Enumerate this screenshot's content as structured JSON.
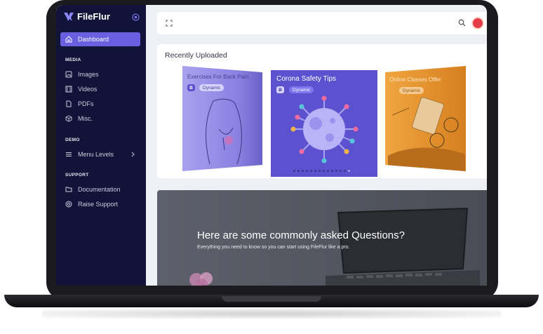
{
  "app": {
    "name": "FileFlur",
    "accent": "#6a5fe0",
    "sidebar_bg": "#111438"
  },
  "sidebar": {
    "dashboard": "Dashboard",
    "sections": {
      "media": "MEDIA",
      "demo": "DEMO",
      "support": "SUPPORT"
    },
    "media_items": [
      "Images",
      "Videos",
      "PDFs",
      "Misc."
    ],
    "demo_items": [
      "Menu Levels"
    ],
    "support_items": [
      "Documentation",
      "Raise Support"
    ]
  },
  "recent": {
    "title": "Recently Uploaded",
    "slides": [
      {
        "title": "Exercises For Back Pain",
        "badge": "B",
        "tag": "Dynamic"
      },
      {
        "title": "Corona Safety Tips",
        "badge": "B",
        "tag": "Dynamic"
      },
      {
        "title": "Online Classes Offer",
        "badge": "",
        "tag": "Dynamic"
      }
    ],
    "carousel": {
      "total": 14,
      "active": 13
    }
  },
  "faq": {
    "title": "Here are some commonly asked Questions?",
    "subtitle": "Everything you need to know so you can start using FileFlur like a pro."
  },
  "icons": [
    "home-icon",
    "image-icon",
    "video-icon",
    "file-icon",
    "box-icon",
    "menu-icon",
    "chevron-right-icon",
    "folder-icon",
    "lifebuoy-icon",
    "fullscreen-icon",
    "search-icon"
  ]
}
